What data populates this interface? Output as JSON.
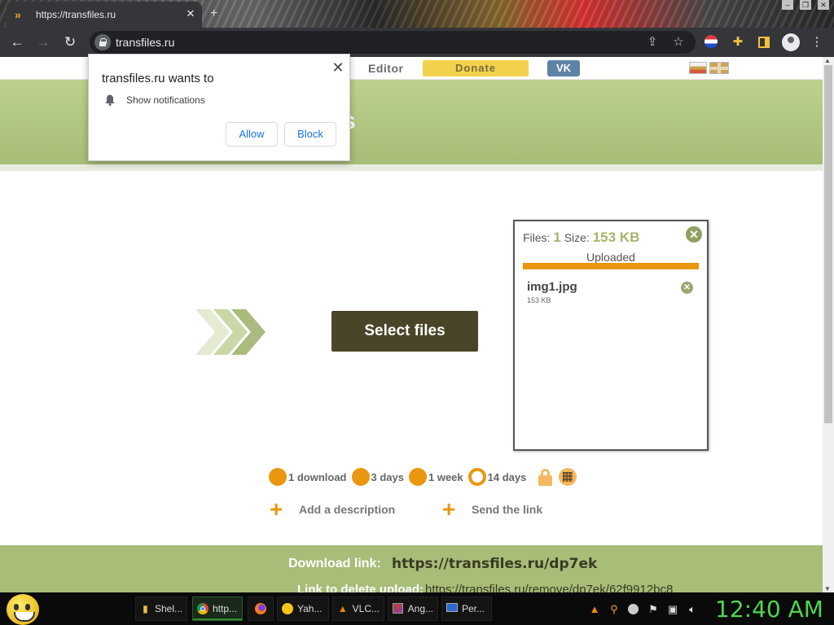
{
  "browser": {
    "tab_title": "https://transfiles.ru",
    "tab_close": "✕",
    "new_tab": "+",
    "url": "transfiles.ru"
  },
  "nav": {
    "editor": "Editor",
    "donate": "Donate",
    "vk": "VK"
  },
  "hero": {
    "title_fragment": "s"
  },
  "notification": {
    "title": "transfiles.ru wants to",
    "permission": "Show notifications",
    "allow": "Allow",
    "block": "Block",
    "close": "✕"
  },
  "upload": {
    "select_files": "Select files",
    "files_label": "Files:",
    "files_count": "1",
    "size_label": "Size:",
    "total_size": "153 KB",
    "status": "Uploaded",
    "progress_fraction": 1.0,
    "files": [
      {
        "name": "img1.jpg",
        "size": "153 KB"
      }
    ]
  },
  "options": {
    "items": [
      {
        "label": "1 download",
        "selected": false
      },
      {
        "label": "3 days",
        "selected": false
      },
      {
        "label": "1 week",
        "selected": false
      },
      {
        "label": "14 days",
        "selected": true
      }
    ],
    "add_description": "Add a description",
    "send_link": "Send the link"
  },
  "footer": {
    "download_label": "Download link:",
    "download_url": "https://transfiles.ru/dp7ek",
    "delete_label": "Link to delete upload:",
    "delete_url": "https://transfiles.ru/remove/dp7ek/62f9912bc8"
  },
  "taskbar": {
    "tasks": [
      {
        "label": "Shel...",
        "icon": "folder-icon"
      },
      {
        "label": "http...",
        "icon": "chrome-icon",
        "active": true
      },
      {
        "label": "",
        "icon": "firefox-icon"
      },
      {
        "label": "Yah...",
        "icon": "yahoo-messenger-icon"
      },
      {
        "label": "VLC...",
        "icon": "vlc-icon"
      },
      {
        "label": "Ang...",
        "icon": "app-icon"
      },
      {
        "label": "Per...",
        "icon": "monitor-icon"
      }
    ],
    "clock": "12:40 AM"
  },
  "colors": {
    "accent_orange": "#ea960f",
    "hero_green": "#a7bd78",
    "button_dark": "#4a4428",
    "donate_yellow": "#f2d14d",
    "vk_blue": "#5e83a6",
    "clock_green": "#4fd64f"
  }
}
